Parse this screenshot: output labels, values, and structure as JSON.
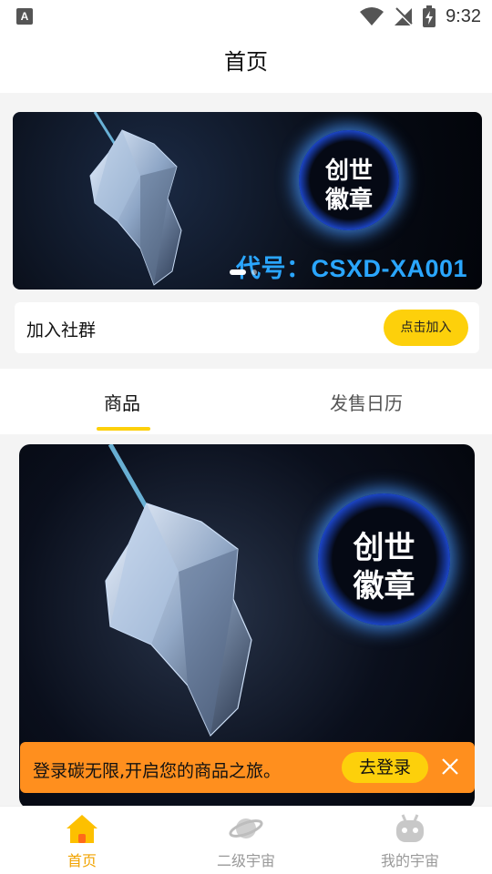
{
  "status_bar": {
    "time": "9:32",
    "left_icon": "A"
  },
  "header": {
    "title": "首页"
  },
  "banner": {
    "badge_line1": "创世",
    "badge_line2": "徽章",
    "code_text": "代号：CSXD-XA001"
  },
  "community": {
    "label": "加入社群",
    "join_label": "点击加入"
  },
  "tabs": [
    {
      "label": "商品",
      "active": true
    },
    {
      "label": "发售日历",
      "active": false
    }
  ],
  "product_card": {
    "badge_line1": "创世",
    "badge_line2": "徽章"
  },
  "login_prompt": {
    "text": "登录碳无限,开启您的商品之旅。",
    "button_label": "去登录"
  },
  "bottom_nav": [
    {
      "label": "首页",
      "icon": "home-icon",
      "active": true
    },
    {
      "label": "二级宇宙",
      "icon": "planet-icon",
      "active": false
    },
    {
      "label": "我的宇宙",
      "icon": "robot-icon",
      "active": false
    }
  ],
  "colors": {
    "accent_yellow": "#fdd00b",
    "login_bar_orange": "#ff8f1e",
    "active_nav": "#f1a300",
    "banner_code_blue": "#2aa6ff"
  }
}
